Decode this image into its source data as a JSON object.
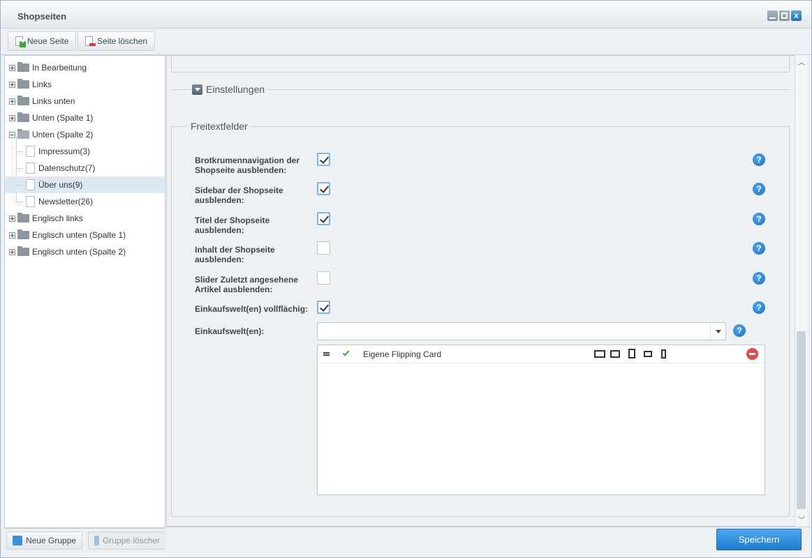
{
  "window": {
    "title": "Shopseiten"
  },
  "toolbar": {
    "new_page": "Neue Seite",
    "delete_page": "Seite löschen"
  },
  "tree": {
    "groups": [
      {
        "label": "In Bearbeitung"
      },
      {
        "label": "Links"
      },
      {
        "label": "Links unten"
      },
      {
        "label": "Unten (Spalte 1)"
      },
      {
        "label": "Unten (Spalte 2)"
      },
      {
        "label": "Englisch links"
      },
      {
        "label": "Englisch unten (Spalte 1)"
      },
      {
        "label": "Englisch unten (Spalte 2)"
      }
    ],
    "pages": [
      {
        "label": "Impressum(3)"
      },
      {
        "label": "Datenschutz(7)"
      },
      {
        "label": "Über uns(9)"
      },
      {
        "label": "Newsletter(26)"
      }
    ],
    "selected": "Über uns(9)"
  },
  "sidebar_footer": {
    "new_group": "Neue Gruppe",
    "delete_group": "Gruppe löscher"
  },
  "settings": {
    "label": "Einstellungen"
  },
  "freitext": {
    "legend": "Freitextfelder",
    "fields": [
      {
        "label": "Brotkrumennavigation der Shopseite ausblenden:",
        "checked": true
      },
      {
        "label": "Sidebar der Shopseite ausblenden:",
        "checked": true
      },
      {
        "label": "Titel der Shopseite ausblenden:",
        "checked": true
      },
      {
        "label": "Inhalt der Shopseite ausblenden:",
        "checked": false
      },
      {
        "label": "Slider Zuletzt angesehene Artikel ausblenden:",
        "checked": false
      },
      {
        "label": "Einkaufswelt(en) vollflächig:",
        "checked": true
      }
    ],
    "emotion_label": "Einkaufswelt(en):",
    "emotion_value": "",
    "grid": {
      "rows": [
        {
          "name": "Eigene Flipping Card",
          "active": true,
          "devices": [
            "desktop-icon",
            "tablet-landscape-icon",
            "tablet-portrait-icon",
            "phone-landscape-icon",
            "phone-portrait-icon"
          ]
        }
      ]
    }
  },
  "help_glyph": "?",
  "close_glyph": "x",
  "save": "Speichern"
}
